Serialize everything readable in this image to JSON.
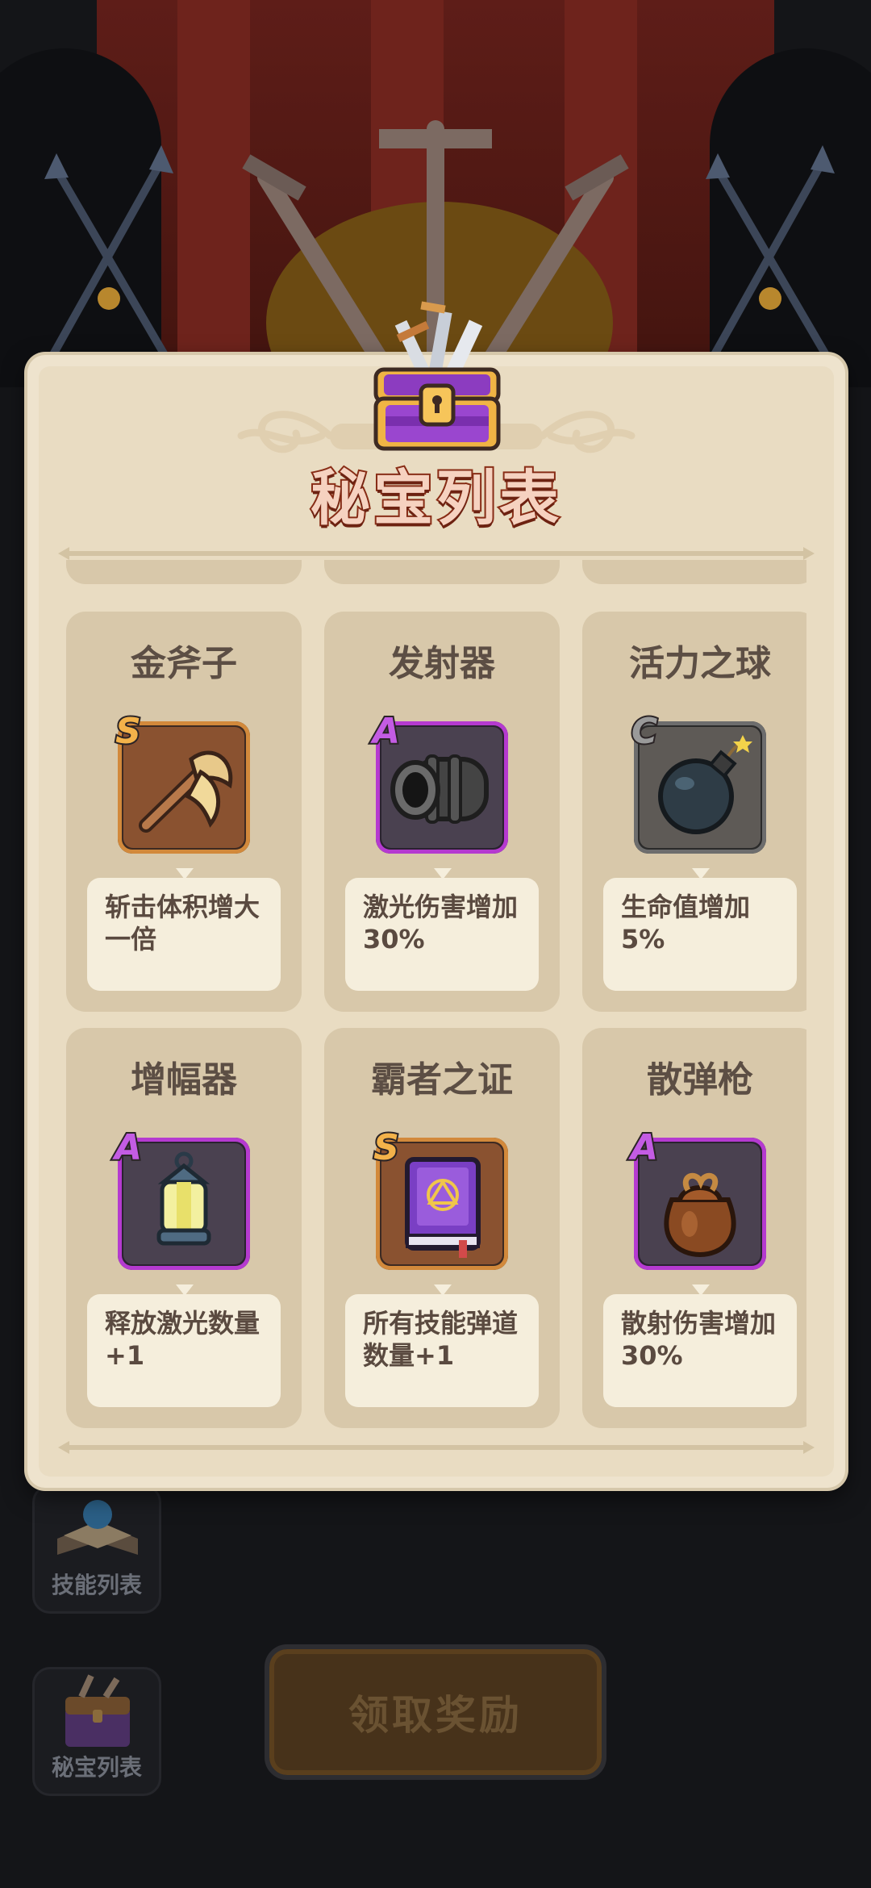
{
  "modal": {
    "title": "秘宝列表"
  },
  "treasures": [
    {
      "name": "金斧子",
      "rank": "S",
      "description": "斩击体积增大一倍",
      "icon": "golden-axe-icon"
    },
    {
      "name": "发射器",
      "rank": "A",
      "description": "激光伤害增加30%",
      "icon": "launcher-cannon-icon"
    },
    {
      "name": "活力之球",
      "rank": "C",
      "description": "生命值增加5%",
      "icon": "bomb-icon"
    },
    {
      "name": "增幅器",
      "rank": "A",
      "description": "释放激光数量+1",
      "icon": "lantern-icon"
    },
    {
      "name": "霸者之证",
      "rank": "S",
      "description": "所有技能弹道数量+1",
      "icon": "purple-book-icon"
    },
    {
      "name": "散弹枪",
      "rank": "A",
      "description": "散射伤害增加30%",
      "icon": "shot-bag-icon"
    }
  ],
  "rank_colors": {
    "S": "#c5802c",
    "A": "#b53ad0",
    "C": "#6d6d6d"
  },
  "side_menu": {
    "skills_label": "技能列表",
    "treasures_label": "秘宝列表"
  },
  "claim_button": {
    "label": "领取奖励"
  }
}
